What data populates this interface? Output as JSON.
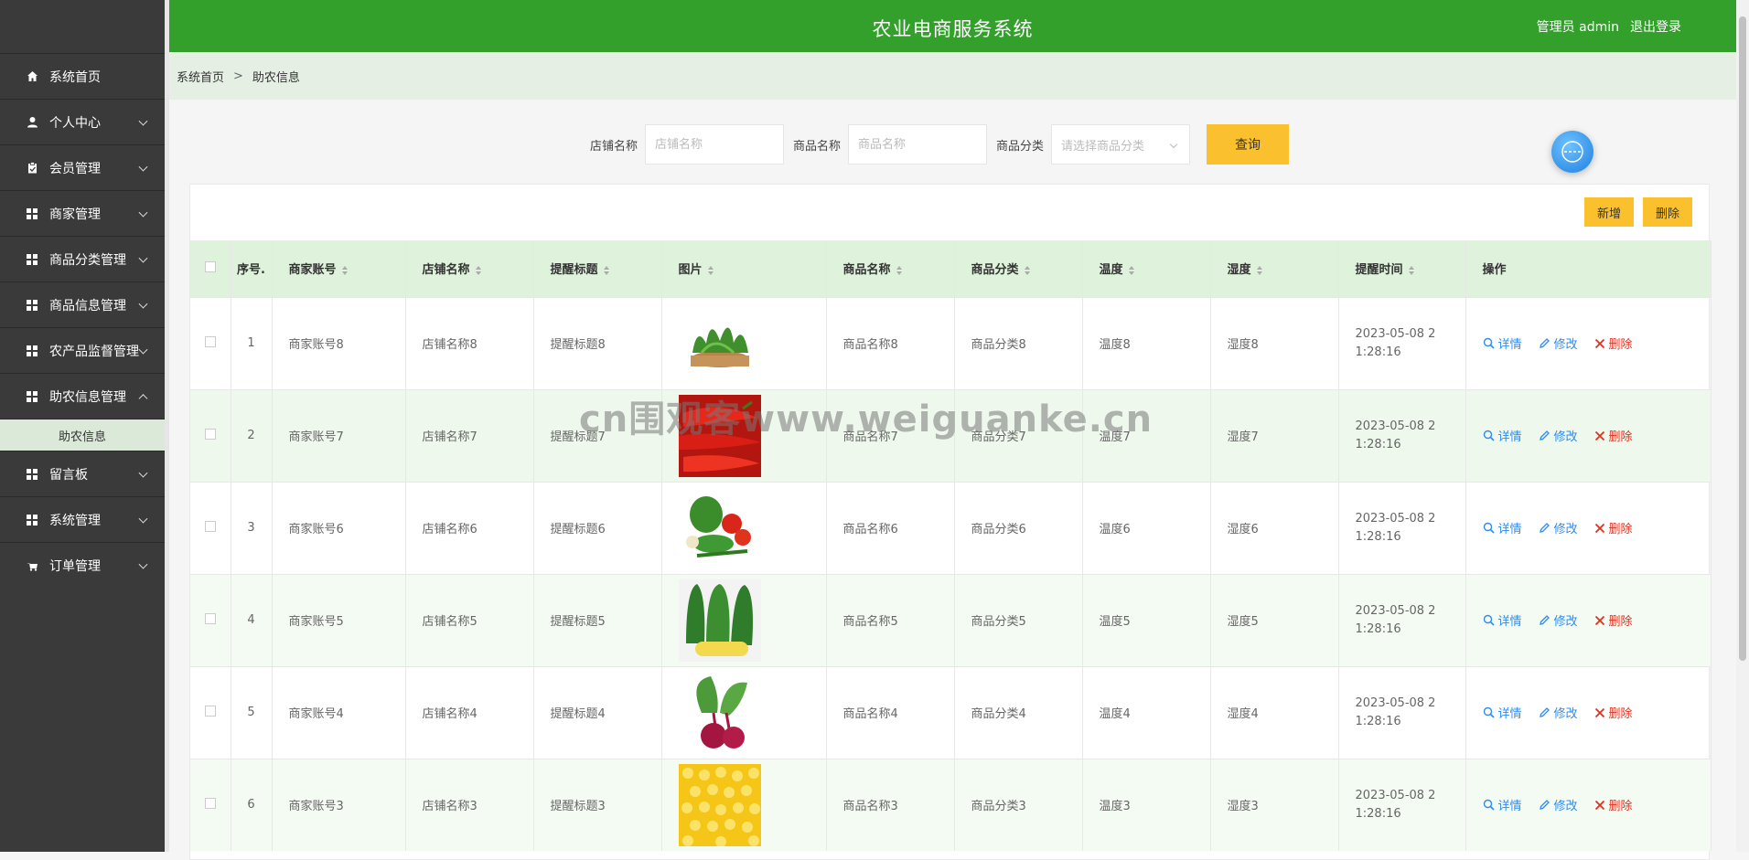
{
  "header": {
    "title": "农业电商服务系统",
    "user": "管理员 admin",
    "logout": "退出登录"
  },
  "sidebar": {
    "items": [
      {
        "label": "系统首页",
        "icon": "home-icon",
        "expandable": false
      },
      {
        "label": "个人中心",
        "icon": "user-icon",
        "expandable": true
      },
      {
        "label": "会员管理",
        "icon": "clipboard-icon",
        "expandable": true
      },
      {
        "label": "商家管理",
        "icon": "grid-icon",
        "expandable": true
      },
      {
        "label": "商品分类管理",
        "icon": "grid-icon",
        "expandable": true
      },
      {
        "label": "商品信息管理",
        "icon": "grid-icon",
        "expandable": true
      },
      {
        "label": "农产品监督管理",
        "icon": "grid-icon",
        "expandable": true
      },
      {
        "label": "助农信息管理",
        "icon": "grid-icon",
        "expandable": true,
        "expanded": true,
        "children": [
          {
            "label": "助农信息"
          }
        ]
      },
      {
        "label": "留言板",
        "icon": "grid-icon",
        "expandable": true
      },
      {
        "label": "系统管理",
        "icon": "grid-icon",
        "expandable": true
      },
      {
        "label": "订单管理",
        "icon": "cart-icon",
        "expandable": true
      }
    ]
  },
  "breadcrumb": {
    "home": "系统首页",
    "separator": ">",
    "current": "助农信息"
  },
  "search": {
    "shop_label": "店铺名称",
    "shop_placeholder": "店铺名称",
    "product_label": "商品名称",
    "product_placeholder": "商品名称",
    "category_label": "商品分类",
    "category_placeholder": "请选择商品分类",
    "query_button": "查询"
  },
  "toolbar": {
    "add": "新增",
    "delete": "删除"
  },
  "table": {
    "columns": [
      "序号",
      "商家账号",
      "店铺名称",
      "提醒标题",
      "图片",
      "商品名称",
      "商品分类",
      "温度",
      "湿度",
      "提醒时间",
      "操作"
    ],
    "index_label": "序号.",
    "actions": {
      "detail": "详情",
      "edit": "修改",
      "delete": "删除"
    },
    "rows": [
      {
        "index": "1",
        "account": "商家账号8",
        "shop": "店铺名称8",
        "title": "提醒标题8",
        "image": "leafy-greens",
        "product": "商品名称8",
        "category": "商品分类8",
        "temp": "温度8",
        "humidity": "湿度8",
        "time": "2023-05-08 21:28:16"
      },
      {
        "index": "2",
        "account": "商家账号7",
        "shop": "店铺名称7",
        "title": "提醒标题7",
        "image": "red-peppers",
        "product": "商品名称7",
        "category": "商品分类7",
        "temp": "温度7",
        "humidity": "湿度7",
        "time": "2023-05-08 21:28:16"
      },
      {
        "index": "3",
        "account": "商家账号6",
        "shop": "店铺名称6",
        "title": "提醒标题6",
        "image": "mixed-vegetables",
        "product": "商品名称6",
        "category": "商品分类6",
        "temp": "温度6",
        "humidity": "湿度6",
        "time": "2023-05-08 21:28:16"
      },
      {
        "index": "4",
        "account": "商家账号5",
        "shop": "店铺名称5",
        "title": "提醒标题5",
        "image": "corn",
        "product": "商品名称5",
        "category": "商品分类5",
        "temp": "温度5",
        "humidity": "湿度5",
        "time": "2023-05-08 21:28:16"
      },
      {
        "index": "5",
        "account": "商家账号4",
        "shop": "店铺名称4",
        "title": "提醒标题4",
        "image": "beetroot",
        "product": "商品名称4",
        "category": "商品分类4",
        "temp": "温度4",
        "humidity": "湿度4",
        "time": "2023-05-08 21:28:16"
      },
      {
        "index": "6",
        "account": "商家账号3",
        "shop": "店铺名称3",
        "title": "提醒标题3",
        "image": "corn-kernels",
        "product": "商品名称3",
        "category": "商品分类3",
        "temp": "温度3",
        "humidity": "湿度3",
        "time": "2023-05-08 21:28:16"
      }
    ]
  },
  "watermark": "cn围观客www.weiguanke.cn",
  "colors": {
    "header": "#33a02c",
    "accent": "#fbc02d",
    "sidebar": "#3a3a3a",
    "row_alt": "#eef8ec"
  }
}
